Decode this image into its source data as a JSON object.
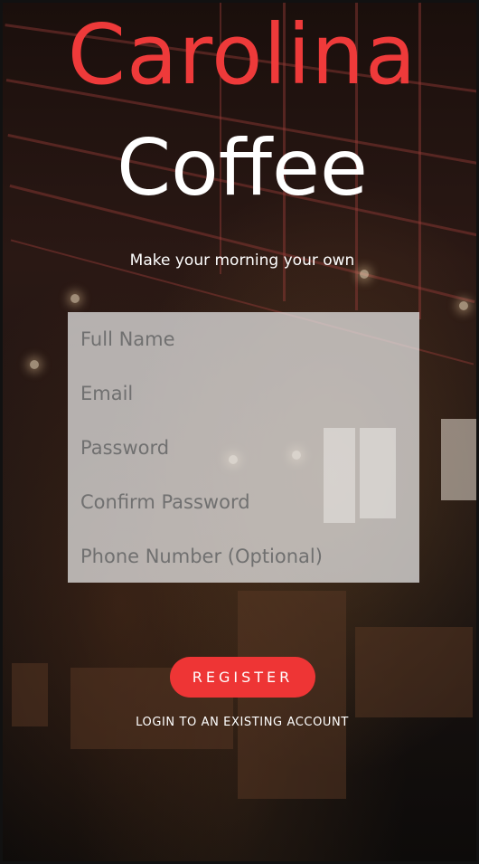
{
  "brand": {
    "title_line1": "Carolina",
    "title_line2": "Coffee",
    "tagline": "Make your morning your own",
    "accent_color": "#ee3a3a"
  },
  "form": {
    "fields": [
      {
        "placeholder": "Full Name"
      },
      {
        "placeholder": "Email"
      },
      {
        "placeholder": "Password"
      },
      {
        "placeholder": "Confirm Password"
      },
      {
        "placeholder": "Phone Number (Optional)"
      }
    ]
  },
  "actions": {
    "register_label": "REGISTER",
    "login_label": "LOGIN TO AN EXISTING ACCOUNT"
  }
}
